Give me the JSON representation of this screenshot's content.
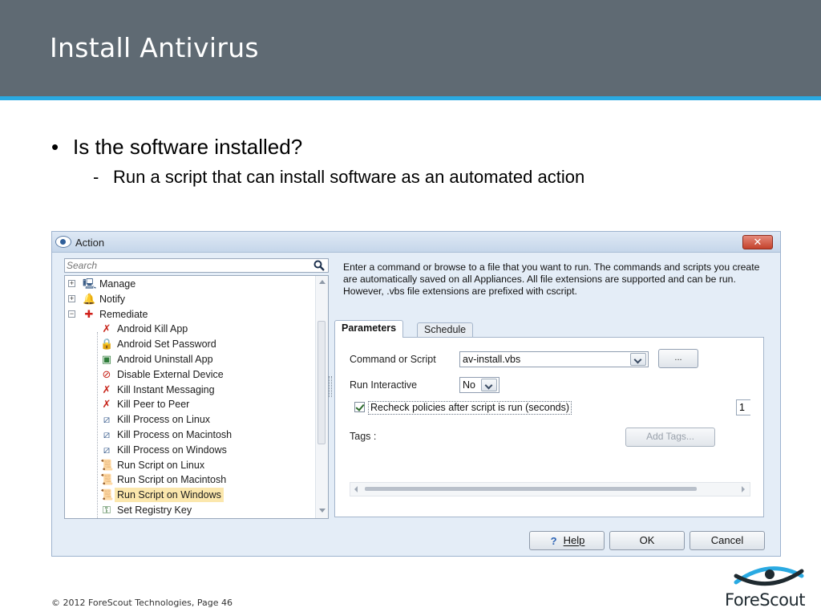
{
  "slide": {
    "title": "Install Antivirus",
    "bullet_1": "Is the software installed?",
    "bullet_2_dash": "-",
    "bullet_2": "Run a script that can install software as an automated action",
    "footer": "© 2012 ForeScout Technologies, Page 46",
    "logo_text": "ForeScout"
  },
  "dialog": {
    "title": "Action",
    "close_label": "✕",
    "search": {
      "placeholder": "Search"
    },
    "tree": [
      {
        "label": "Manage",
        "icon": "manage-icon",
        "level": 0,
        "expander": "+"
      },
      {
        "label": "Notify",
        "icon": "notify-bell-icon",
        "level": 0,
        "expander": "+"
      },
      {
        "label": "Remediate",
        "icon": "remediate-icon",
        "level": 0,
        "expander": "−"
      },
      {
        "label": "Android Kill App",
        "icon": "kill-app-icon",
        "level": 1
      },
      {
        "label": "Android Set Password",
        "icon": "set-password-icon",
        "level": 1
      },
      {
        "label": "Android Uninstall App",
        "icon": "uninstall-app-icon",
        "level": 1
      },
      {
        "label": "Disable External Device",
        "icon": "disable-device-icon",
        "level": 1
      },
      {
        "label": "Kill Instant Messaging",
        "icon": "kill-im-icon",
        "level": 1
      },
      {
        "label": "Kill Peer to Peer",
        "icon": "kill-p2p-icon",
        "level": 1
      },
      {
        "label": "Kill Process on Linux",
        "icon": "kill-process-icon",
        "level": 1
      },
      {
        "label": "Kill Process on Macintosh",
        "icon": "kill-process-icon",
        "level": 1
      },
      {
        "label": "Kill Process on Windows",
        "icon": "kill-process-icon",
        "level": 1
      },
      {
        "label": "Run Script on Linux",
        "icon": "run-script-icon",
        "level": 1
      },
      {
        "label": "Run Script on Macintosh",
        "icon": "run-script-icon",
        "level": 1
      },
      {
        "label": "Run Script on Windows",
        "icon": "run-script-icon",
        "level": 1,
        "selected": true
      },
      {
        "label": "Set Registry Key",
        "icon": "registry-key-icon",
        "level": 1
      }
    ],
    "description": "Enter a command or browse to a file that you want to run. The commands and scripts you create are automatically saved on all Appliances. All file extensions are supported and can be run. However, .vbs file extensions are prefixed with cscript.",
    "tabs": {
      "parameters": "Parameters",
      "schedule": "Schedule"
    },
    "parameters": {
      "command_label": "Command or Script",
      "command_value": "av-install.vbs",
      "browse_label": "...",
      "interactive_label": "Run Interactive",
      "interactive_value": "No",
      "recheck_label": "Recheck policies after script is run (seconds)",
      "recheck_checked": true,
      "recheck_value": "1",
      "tags_label": "Tags :",
      "add_tags_label": "Add Tags..."
    },
    "buttons": {
      "help": "Help",
      "ok": "OK",
      "cancel": "Cancel"
    }
  },
  "colors": {
    "header_bg": "#5f6a73",
    "header_accent": "#2aaae2",
    "selected_item": "#fbe7ad",
    "dialog_bg": "#e4edf7"
  }
}
